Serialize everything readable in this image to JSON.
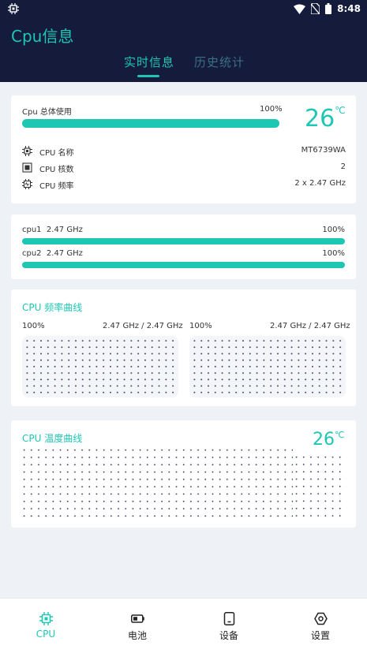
{
  "status_bar": {
    "time": "8:48"
  },
  "app": {
    "title": "Cpu信息"
  },
  "tabs": [
    {
      "label": "实时信息",
      "active": true
    },
    {
      "label": "历史统计",
      "active": false
    }
  ],
  "overview": {
    "usage_label": "Cpu 总体使用",
    "usage_percent_text": "100%",
    "usage_fraction": 1.0,
    "temperature": "26",
    "temperature_unit": "℃",
    "rows": [
      {
        "icon": "cpu-chip-icon",
        "label": "CPU 名称",
        "value": "MT6739WA"
      },
      {
        "icon": "cpu-cores-icon",
        "label": "CPU 核数",
        "value": "2"
      },
      {
        "icon": "cpu-frequency-icon",
        "label": "CPU 频率",
        "value": "2 x 2.47 GHz"
      }
    ]
  },
  "cores": [
    {
      "name": "cpu1",
      "freq": "2.47 GHz",
      "percent_text": "100%",
      "fraction": 1.0
    },
    {
      "name": "cpu2",
      "freq": "2.47 GHz",
      "percent_text": "100%",
      "fraction": 1.0
    }
  ],
  "freq_curve": {
    "title": "CPU 频率曲线",
    "charts": [
      {
        "percent": "100%",
        "freq": "2.47 GHz / 2.47 GHz"
      },
      {
        "percent": "100%",
        "freq": "2.47 GHz / 2.47 GHz"
      }
    ]
  },
  "temp_curve": {
    "title": "CPU 温度曲线",
    "temperature": "26",
    "unit": "℃"
  },
  "nav": [
    {
      "label": "CPU",
      "icon": "cpu-icon",
      "active": true
    },
    {
      "label": "电池",
      "icon": "battery-icon",
      "active": false
    },
    {
      "label": "设备",
      "icon": "device-icon",
      "active": false
    },
    {
      "label": "设置",
      "icon": "settings-icon",
      "active": false
    }
  ],
  "colors": {
    "accent": "#1ec7b4",
    "header": "#151b3a",
    "background": "#eef1f5"
  }
}
